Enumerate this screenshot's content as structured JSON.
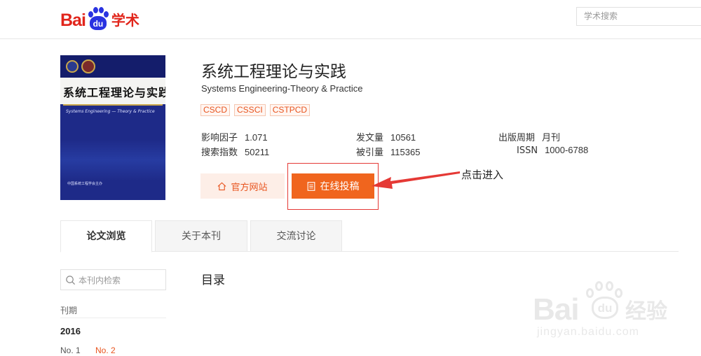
{
  "header": {
    "logo_latin": "Bai",
    "logo_paw": "du",
    "logo_cn": "学术",
    "search_placeholder": "学术搜索"
  },
  "journal": {
    "cover_title": "系统工程理论与实践",
    "cover_subtitle": "Systems Engineering — Theory & Practice",
    "cover_publisher": "中国系统工程学会主办",
    "title": "系统工程理论与实践",
    "title_en": "Systems Engineering-Theory & Practice",
    "tags": [
      "CSCD",
      "CSSCI",
      "CSTPCD"
    ],
    "stats": {
      "impact_label": "影响因子",
      "impact_value": "1.071",
      "articles_label": "发文量",
      "articles_value": "10561",
      "cycle_label": "出版周期",
      "cycle_value": "月刊",
      "search_label": "搜索指数",
      "search_value": "50211",
      "cited_label": "被引量",
      "cited_value": "115365",
      "issn_label": "ISSN",
      "issn_value": "1000-6788"
    },
    "site_button": "官方网站",
    "submit_button": "在线投稿",
    "annotation": "点击进入"
  },
  "tabs": [
    {
      "label": "论文浏览",
      "active": true
    },
    {
      "label": "关于本刊",
      "active": false
    },
    {
      "label": "交流讨论",
      "active": false
    }
  ],
  "sidebar": {
    "search_placeholder": "本刊内检索",
    "period_label": "刊期",
    "year": "2016",
    "issues": [
      "No. 1",
      "No. 2"
    ],
    "active_issue": "No. 2"
  },
  "main": {
    "toc_title": "目录"
  },
  "watermark": {
    "logo_latin": "Bai",
    "logo_paw": "du",
    "logo_cn": "经验",
    "url": "jingyan.baidu.com"
  },
  "colors": {
    "brand_red": "#e1251b",
    "brand_blue": "#2932e1",
    "accent_orange": "#f0651e",
    "annotation_red": "#e53935"
  }
}
